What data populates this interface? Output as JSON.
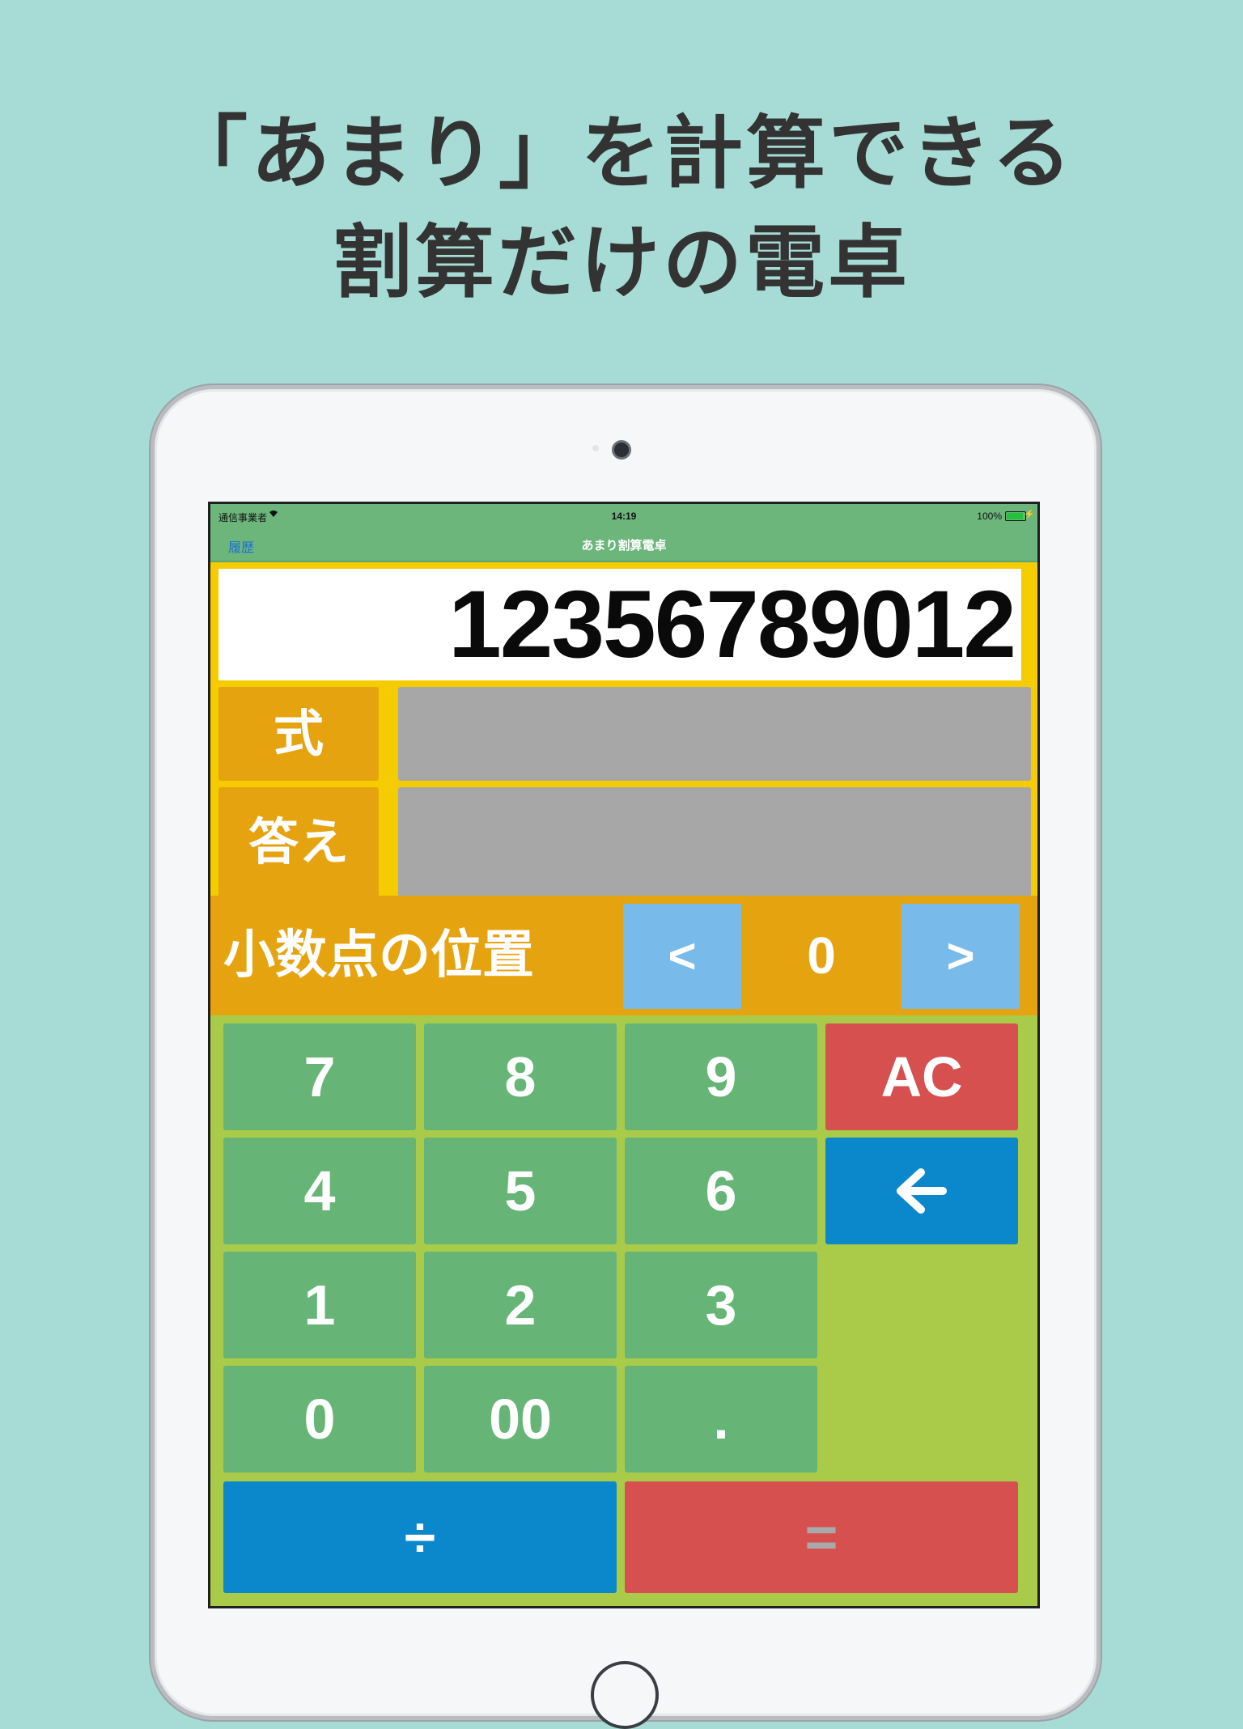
{
  "headline": {
    "line1": "「あまり」を計算できる",
    "line2": "割算だけの電卓"
  },
  "status_bar": {
    "carrier": "通信事業者",
    "time": "14:19",
    "battery": "100%"
  },
  "nav_bar": {
    "back_label": "履歴",
    "title": "あまり割算電卓"
  },
  "display": {
    "value": "12356789012"
  },
  "rows": {
    "expression_label": "式",
    "expression_value": "",
    "answer_label": "答え",
    "answer_value": ""
  },
  "decimal": {
    "label": "小数点の位置",
    "left": "<",
    "value": "0",
    "right": ">"
  },
  "keys": {
    "k7": "7",
    "k8": "8",
    "k9": "9",
    "ac": "AC",
    "k4": "4",
    "k5": "5",
    "k6": "6",
    "backspace": "🡐",
    "k1": "1",
    "k2": "2",
    "k3": "3",
    "k0": "0",
    "k00": "00",
    "dot": ".",
    "divide": "÷",
    "equals": "="
  },
  "colors": {
    "background": "#a7dcd6",
    "bar_green": "#6cb57b",
    "key_green": "#66b577",
    "key_red": "#d75050",
    "key_blue": "#0b88cb",
    "label_orange": "#e5a30f",
    "arrow_blue": "#78bbea",
    "keypad_bg": "#aacb4a"
  }
}
